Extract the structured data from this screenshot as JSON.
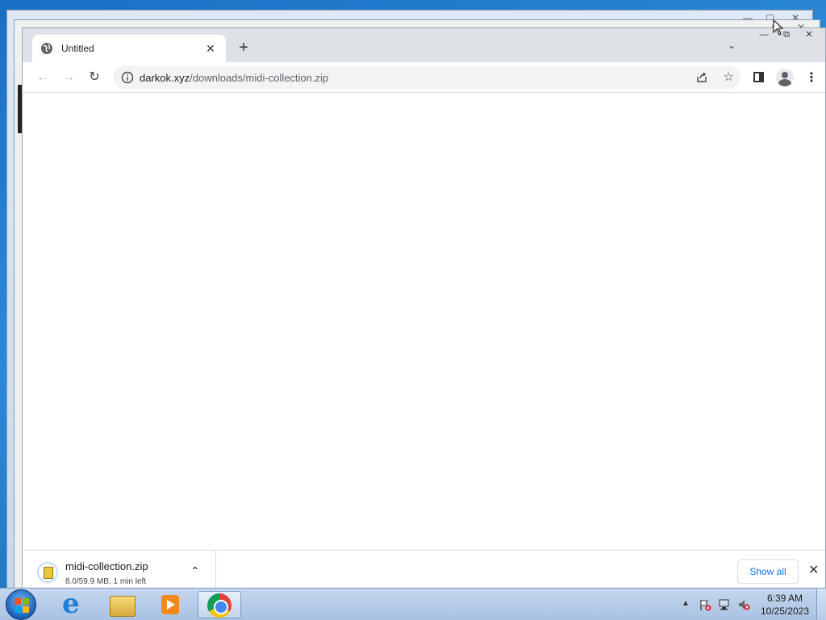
{
  "browser": {
    "tab": {
      "title": "Untitled",
      "close_glyph": "✕"
    },
    "new_tab_glyph": "+",
    "tab_search_glyph": "⌄",
    "window_controls": {
      "minimize": "—",
      "maximize": "⧉",
      "close": "✕"
    },
    "nav": {
      "back": "←",
      "forward": "→",
      "reload": "↻"
    },
    "address": {
      "host": "darkok.xyz",
      "path": "/downloads/midi-collection.zip"
    },
    "menu_glyph": "⋮",
    "star_glyph": "☆"
  },
  "download_bar": {
    "item": {
      "filename": "midi-collection.zip",
      "status": "8.0/59.9 MB, 1 min left",
      "chevron": "⌃"
    },
    "show_all_label": "Show all",
    "close_glyph": "✕"
  },
  "taskbar": {
    "apps": [
      "internet-explorer-icon",
      "file-explorer-icon",
      "media-player-icon",
      "chrome-icon"
    ],
    "tray_up_glyph": "▲",
    "clock": {
      "time": "6:39 AM",
      "date": "10/25/2023"
    }
  },
  "background_windows": {
    "controls": [
      "—",
      "▢",
      "✕"
    ]
  }
}
